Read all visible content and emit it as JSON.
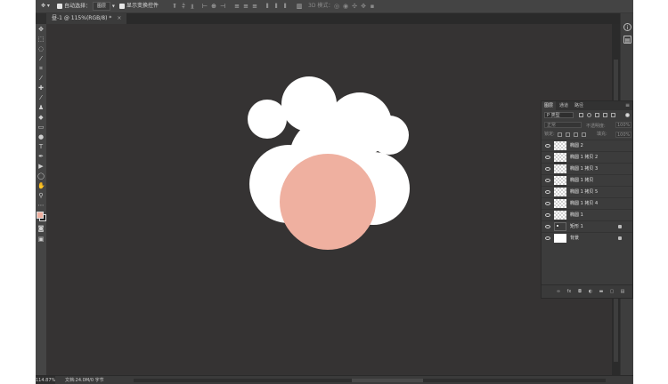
{
  "options_bar": {
    "auto_select_checked": true,
    "auto_select_label": "自动选择：",
    "auto_select_value": "图层",
    "show_transform_checked": true,
    "show_transform_label": "显示变换控件",
    "mode_3d_label": "3D 模式："
  },
  "document_tab": {
    "title": "昼-1 @ 115%(RGB/8) *",
    "close_glyph": "×"
  },
  "canvas": {
    "background": "#353333",
    "flower_color": "#ffffff",
    "center_color": "#efb0a0"
  },
  "tools": {
    "foreground_color": "#efb0a0",
    "background_color": "#222222",
    "text_tool_glyph": "T"
  },
  "layers_panel": {
    "tabs": [
      "图层",
      "通道",
      "路径"
    ],
    "kind_label": "P 类型",
    "blend_mode": "正常",
    "opacity_label": "不透明度:",
    "opacity_value": "100%",
    "lock_label": "锁定:",
    "fill_label": "填充:",
    "fill_value": "100%",
    "layers": [
      {
        "name": "椭圆 2",
        "thumb": "checker"
      },
      {
        "name": "椭圆 1 拷贝 2",
        "thumb": "checker"
      },
      {
        "name": "椭圆 1 拷贝 3",
        "thumb": "checker"
      },
      {
        "name": "椭圆 1 拷贝",
        "thumb": "checker"
      },
      {
        "name": "椭圆 1 拷贝 5",
        "thumb": "checker"
      },
      {
        "name": "椭圆 1 拷贝 4",
        "thumb": "checker"
      },
      {
        "name": "椭圆 1",
        "thumb": "checker"
      },
      {
        "name": "矩形 1",
        "thumb": "rect",
        "locked": true
      },
      {
        "name": "背景",
        "thumb": "white",
        "locked": true
      }
    ]
  },
  "status": {
    "zoom": "114.87%",
    "doc_info": "文档:24.0M/0 字节"
  }
}
